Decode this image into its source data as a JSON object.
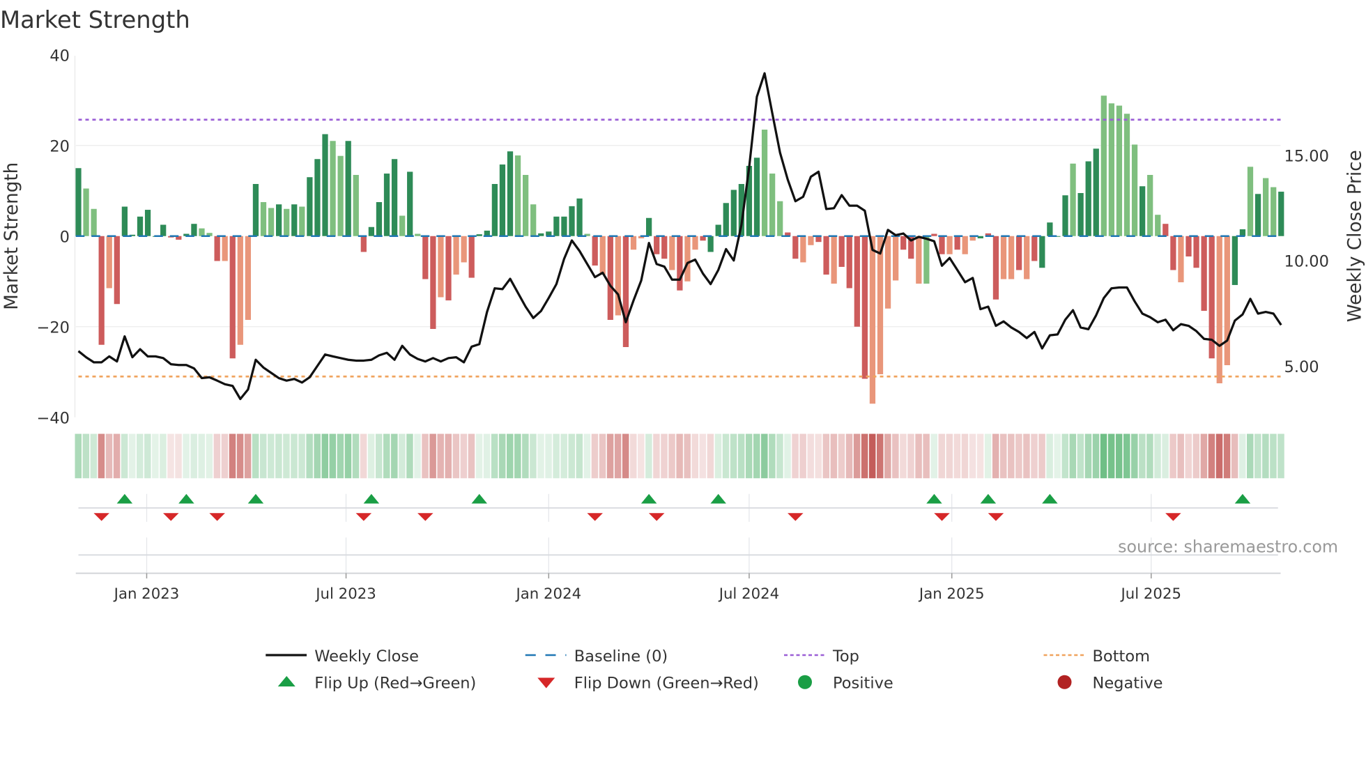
{
  "chart_data": {
    "type": "bar+line",
    "title": "Market Strength",
    "ylabel_left": "Market Strength",
    "ylabel_right": "Weekly Close Price",
    "ylim_left": [
      -40,
      40
    ],
    "ylim_right": [
      2.56,
      19.71
    ],
    "left_ticks": [
      "40",
      "20",
      "0",
      "−20",
      "−40"
    ],
    "left_tick_values": [
      40,
      20,
      0,
      -20,
      -40
    ],
    "right_ticks": [
      "15.00",
      "10.00",
      "5.00"
    ],
    "right_tick_values": [
      15,
      10,
      5
    ],
    "start_week": "2022-10-31",
    "x_ticks": [
      {
        "label": "Jan 2023",
        "date": "2023-01-01"
      },
      {
        "label": "Jul 2023",
        "date": "2023-07-01"
      },
      {
        "label": "Jan 2024",
        "date": "2024-01-01"
      },
      {
        "label": "Jul 2024",
        "date": "2024-07-01"
      },
      {
        "label": "Jan 2025",
        "date": "2025-01-01"
      },
      {
        "label": "Jul 2025",
        "date": "2025-07-01"
      }
    ],
    "top_level": 25.7,
    "bottom_level": -31,
    "strength": [
      15,
      10.5,
      6,
      -24,
      -11.5,
      -15,
      6.5,
      0.3,
      4.3,
      5.8,
      0,
      2.5,
      -0.3,
      -0.8,
      0.5,
      2.7,
      1.7,
      0.7,
      -5.5,
      -5.5,
      -27,
      -24,
      -18.5,
      11.5,
      7.5,
      6.2,
      7,
      6,
      7,
      6.5,
      13,
      17,
      22.5,
      21,
      17.7,
      21,
      13.5,
      -3.5,
      2,
      7.5,
      13.8,
      17,
      4.5,
      14.2,
      0.5,
      -9.5,
      -20.5,
      -13.5,
      -14.2,
      -8.5,
      -5.8,
      -9.2,
      0.4,
      1.2,
      11.5,
      15.8,
      18.7,
      17.8,
      13.5,
      7,
      0.6,
      1,
      4.3,
      4.3,
      6.6,
      8.3,
      0.5,
      -6.5,
      -8.5,
      -18.5,
      -17.5,
      -24.5,
      -3,
      -0.5,
      4,
      -4,
      -5,
      -7.5,
      -12,
      -10,
      -3,
      -1,
      -3.5,
      2.5,
      7.3,
      10.2,
      11.5,
      15.5,
      17.3,
      23.5,
      13.8,
      7.7,
      0.8,
      -5,
      -5.8,
      -2,
      -1.3,
      -8.5,
      -10.5,
      -6.8,
      -11.5,
      -20,
      -31.5,
      -37,
      -30.5,
      -16,
      -9.8,
      -3,
      -5,
      -10.5,
      -10.5,
      0.5,
      -4,
      -4,
      -3,
      -4,
      -1,
      -0.5,
      0.6,
      -14,
      -9.5,
      -9.5,
      -7.5,
      -9.5,
      -5.5,
      -7,
      3,
      0,
      9,
      16,
      9.5,
      16.5,
      19.3,
      31,
      29.3,
      28.8,
      27,
      20.2,
      11,
      13.5,
      4.7,
      2.7,
      -7.5,
      -10.2,
      -4.5,
      -7,
      -16.5,
      -27,
      -32.5,
      -28.5,
      -10.8,
      1.5,
      15.3,
      9.3,
      12.8,
      10.8,
      9.8
    ],
    "strength_state": "GggRrRGGGGGGRRGGggRrRrrGggGgGgGGGggGgRGGGGgGgRRrRrrRGGGGGgggGGGGGGgRrRrRrrGRRrRrrRGGGGGGGgggRRrrRRrRRRRrrrrRRrgRRrRrrGRRrrRrRGGGGgGGGgggggGggRRrRRRRrrGGgGgg",
    "close": [
      5.7,
      5.41,
      5.17,
      5.17,
      5.45,
      5.21,
      6.4,
      5.41,
      5.79,
      5.45,
      5.45,
      5.37,
      5.08,
      5.04,
      5.04,
      4.88,
      4.42,
      4.46,
      4.3,
      4.13,
      4.05,
      3.43,
      3.88,
      5.29,
      4.92,
      4.67,
      4.42,
      4.3,
      4.38,
      4.21,
      4.46,
      5.0,
      5.54,
      5.45,
      5.37,
      5.29,
      5.25,
      5.25,
      5.29,
      5.5,
      5.62,
      5.29,
      5.95,
      5.54,
      5.33,
      5.21,
      5.37,
      5.21,
      5.37,
      5.41,
      5.17,
      5.91,
      6.03,
      7.56,
      8.68,
      8.64,
      9.13,
      8.47,
      7.81,
      7.27,
      7.6,
      8.22,
      8.88,
      10.08,
      10.95,
      10.45,
      9.83,
      9.21,
      9.42,
      8.8,
      8.39,
      7.07,
      8.1,
      9.05,
      10.83,
      9.83,
      9.71,
      9.09,
      9.09,
      9.88,
      10.04,
      9.38,
      8.88,
      9.55,
      10.54,
      10.0,
      11.69,
      14.42,
      17.77,
      18.88,
      16.98,
      15.12,
      13.84,
      12.81,
      13.02,
      13.97,
      14.21,
      12.44,
      12.48,
      13.1,
      12.6,
      12.6,
      12.36,
      10.5,
      10.33,
      11.45,
      11.2,
      11.28,
      10.95,
      11.12,
      11.03,
      10.91,
      9.75,
      10.12,
      9.55,
      8.97,
      9.17,
      7.69,
      7.81,
      6.9,
      7.11,
      6.82,
      6.61,
      6.32,
      6.61,
      5.83,
      6.45,
      6.49,
      7.19,
      7.64,
      6.82,
      6.74,
      7.4,
      8.22,
      8.68,
      8.72,
      8.72,
      8.06,
      7.48,
      7.31,
      7.07,
      7.19,
      6.69,
      6.98,
      6.9,
      6.65,
      6.28,
      6.24,
      5.95,
      6.2,
      7.15,
      7.44,
      8.18,
      7.48,
      7.56,
      7.48,
      6.94
    ],
    "flip_up_weeks": [
      6,
      14,
      23,
      38,
      52,
      74,
      83,
      111,
      118,
      126,
      151
    ],
    "flip_down_weeks": [
      3,
      12,
      18,
      37,
      45,
      67,
      75,
      93,
      112,
      119,
      142
    ],
    "colors": {
      "strong_positive": "#2e8b57",
      "weak_positive": "#7fbf7f",
      "strong_negative": "#cd5c5c",
      "weak_negative": "#e9967a",
      "close": "#111111",
      "baseline": "#1f77b4",
      "top": "#9b5fd6",
      "bottom": "#f0a35e",
      "flip_up": "#1a9e45",
      "flip_down": "#d62728",
      "positive": "#1a9e45",
      "negative": "#b22222"
    },
    "legend": [
      {
        "label": "Weekly Close",
        "symbol": "line"
      },
      {
        "label": "Baseline (0)",
        "symbol": "dash"
      },
      {
        "label": "Top",
        "symbol": "dot-purple"
      },
      {
        "label": "Bottom",
        "symbol": "dot-orange"
      },
      {
        "label": "Flip Up (Red→Green)",
        "symbol": "triangle-up"
      },
      {
        "label": "Flip Down (Green→Red)",
        "symbol": "triangle-down"
      },
      {
        "label": "Positive",
        "symbol": "circle-green"
      },
      {
        "label": "Negative",
        "symbol": "circle-red"
      }
    ],
    "legend_position": "bottom",
    "source": "source: sharemaestro.com"
  }
}
